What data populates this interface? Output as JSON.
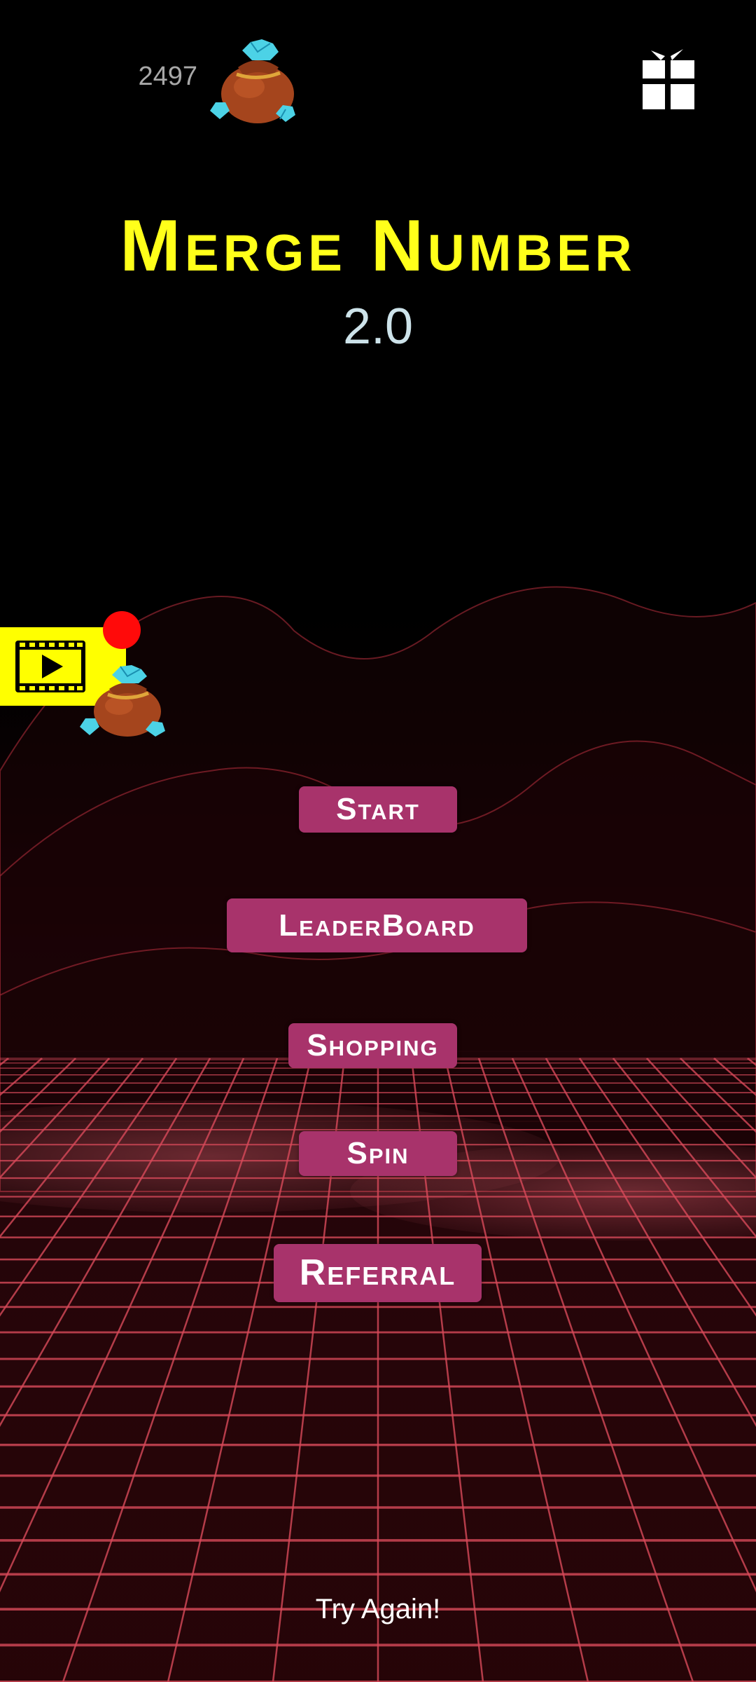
{
  "header": {
    "coin_count": "2497"
  },
  "title": {
    "main": "Merge Number",
    "version": "2.0"
  },
  "menu": {
    "start": "Start",
    "leaderboard": "LeaderBoard",
    "shopping": "Shopping",
    "spin": "Spin",
    "referral": "Referral"
  },
  "footer": {
    "try_again": "Try Again!"
  },
  "icons": {
    "top_bag": "coin-bag-icon",
    "gift": "gift-icon",
    "video_ad": "video-ad-icon",
    "reward_bag": "reward-bag-icon"
  },
  "colors": {
    "title": "#ffff1a",
    "version": "#cde3ea",
    "button": "#a8336b",
    "ad_background": "#ffff00",
    "notification_dot": "#ff0a0a",
    "grid": "#d84a5a"
  }
}
